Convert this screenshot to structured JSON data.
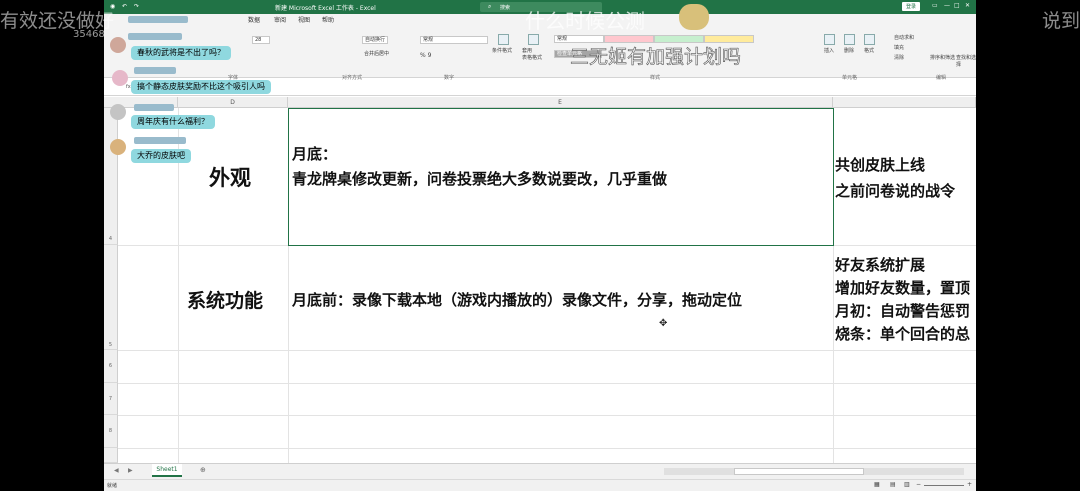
{
  "titlebar": {
    "title": "新建 Microsoft Excel 工作表 - Excel",
    "search_placeholder": "搜索",
    "login_label": "登录"
  },
  "ribbon": {
    "tabs": [
      "数据",
      "审阅",
      "视图",
      "帮助"
    ],
    "font_size": "28",
    "wrap_text": "自动换行",
    "merge_center": "合并后居中",
    "number_format": "常规",
    "conditional_format": "条件格式",
    "format_as_table": "套用\n表格格式",
    "styles": [
      "常规",
      "检查单元格"
    ],
    "cells": [
      "插入",
      "删除",
      "格式"
    ],
    "editing": [
      "自动求和",
      "填充",
      "清除",
      "排序和筛选",
      "查找和选择"
    ],
    "groups": [
      "字体",
      "对齐方式",
      "数字",
      "样式",
      "单元格",
      "编辑"
    ]
  },
  "sheet": {
    "columns": [
      "D",
      "E"
    ],
    "rows": [
      "4",
      "5",
      "6",
      "7",
      "8"
    ],
    "cells": {
      "appearance_label": "外观",
      "appearance_line1": "月底：",
      "appearance_line2": "青龙牌桌修改更新，问卷投票绝大多数说要改，几乎重做",
      "appearance_next_1": "共创皮肤上线",
      "appearance_next_2": "之前问卷说的战令",
      "system_label": "系统功能",
      "system_line1": "月底前：录像下载本地（游戏内播放的）录像文件，分享，拖动定位",
      "system_next_1": "好友系统扩展",
      "system_next_2": "增加好友数量，置顶",
      "system_next_3": "月初：自动警告惩罚",
      "system_next_4": "烧条：单个回合的总"
    },
    "tab_name": "Sheet1"
  },
  "status": {
    "ready": "就绪"
  },
  "overlay": {
    "danmaku_left": "有效还没做好",
    "danmaku_right": "说到",
    "danmaku_top": "什么时候公测",
    "danmaku_mid": "三无姬有加强计划吗",
    "viewer_number": "35468"
  },
  "chat": [
    "春秋的武将是不出了吗？",
    "搞个静态皮肤奖励不比这个吸引人吗",
    "周年庆有什么福利？",
    "大乔的皮肤吧"
  ]
}
